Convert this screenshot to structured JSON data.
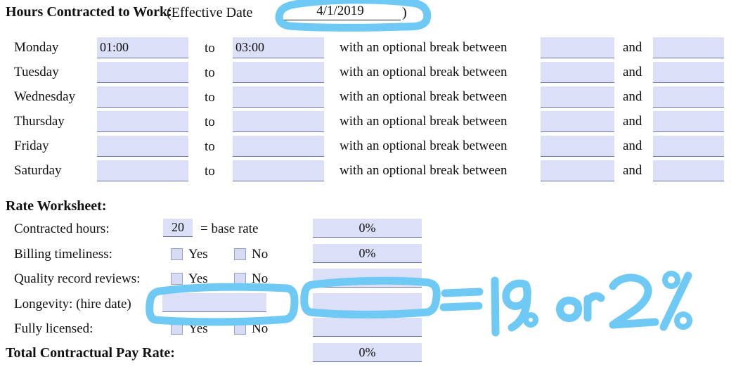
{
  "header": {
    "title": "Hours Contracted to Work:",
    "effective_label": "(Effective Date",
    "effective_date_value": "4/1/2019",
    "paren_close": ")"
  },
  "schedule": {
    "to_label": "to",
    "break_label": "with an optional break between",
    "and_label": "and",
    "rows": [
      {
        "day": "Monday",
        "start": "01:00",
        "end": "03:00",
        "break_start": "",
        "break_end": ""
      },
      {
        "day": "Tuesday",
        "start": "",
        "end": "",
        "break_start": "",
        "break_end": ""
      },
      {
        "day": "Wednesday",
        "start": "",
        "end": "",
        "break_start": "",
        "break_end": ""
      },
      {
        "day": "Thursday",
        "start": "",
        "end": "",
        "break_start": "",
        "break_end": ""
      },
      {
        "day": "Friday",
        "start": "",
        "end": "",
        "break_start": "",
        "break_end": ""
      },
      {
        "day": "Saturday",
        "start": "",
        "end": "",
        "break_start": "",
        "break_end": ""
      }
    ]
  },
  "rate_worksheet": {
    "section_title": "Rate Worksheet:",
    "yes_label": "Yes",
    "no_label": "No",
    "contracted_hours": {
      "label": "Contracted hours:",
      "value": "20",
      "equals_text": "= base rate",
      "percent": "0%"
    },
    "billing_timeliness": {
      "label": "Billing timeliness:",
      "percent": "0%"
    },
    "quality_record_reviews": {
      "label": "Quality record reviews:",
      "percent": ""
    },
    "longevity": {
      "label": "Longevity: (hire date)",
      "value": "",
      "percent": ""
    },
    "fully_licensed": {
      "label": "Fully licensed:",
      "percent": ""
    },
    "total": {
      "label": "Total Contractual Pay Rate:",
      "percent": "0%"
    }
  },
  "annotations": {
    "ink_color": "#6fc9f5",
    "date_circle": "oval around effective date field",
    "longevity_box": "rectangle around longevity input",
    "percent_box": "rectangle around longevity percent field",
    "handwriting": "= 1% or 2%"
  }
}
